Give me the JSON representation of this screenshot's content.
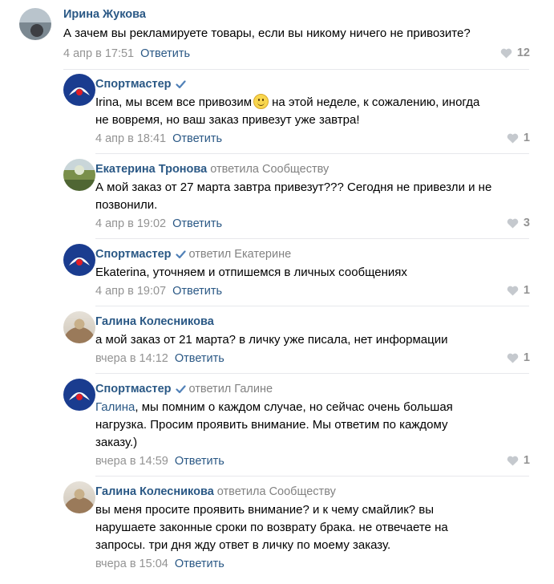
{
  "colors": {
    "link": "#2a5885",
    "muted": "#939393",
    "brand": "#1a3c8f",
    "separator": "#e7e8ec"
  },
  "reply_label": "Ответить",
  "comments": [
    {
      "author": "Ирина Жукова",
      "avatar_icon": "user-photo-icon",
      "verified": false,
      "reply_to": "",
      "lines": [
        "А зачем вы рекламируете товары, если вы никому ничего не привозите?"
      ],
      "time": "4 апр в 17:51",
      "likes": "12"
    },
    {
      "author": "Спортмастер",
      "avatar_icon": "brand-logo-icon",
      "verified": true,
      "reply_to": "",
      "line1_before": "Irina, мы всем все привозим",
      "line1_after": "на этой неделе, к сожалению, иногда",
      "line2": "не вовремя, но ваш заказ привезут уже завтра!",
      "time": "4 апр в 18:41",
      "likes": "1"
    },
    {
      "author": "Екатерина Тронова",
      "avatar_icon": "landscape-photo-icon",
      "verified": false,
      "reply_to": "ответила Сообществу",
      "lines": [
        "А мой заказ от 27 марта завтра привезут??? Сегодня не привезли и не",
        "позвонили."
      ],
      "time": "4 апр в 19:02",
      "likes": "3"
    },
    {
      "author": "Спортмастер",
      "avatar_icon": "brand-logo-icon",
      "verified": true,
      "reply_to": "ответил Екатерине",
      "lines": [
        "Ekaterina, уточняем и отпишемся в личных сообщениях"
      ],
      "time": "4 апр в 19:07",
      "likes": "1"
    },
    {
      "author": "Галина Колесникова",
      "avatar_icon": "user-photo-icon",
      "verified": false,
      "reply_to": "",
      "lines": [
        "а мой заказ от 21 марта? в личку уже писала, нет информации"
      ],
      "time": "вчера в 14:12",
      "likes": "1"
    },
    {
      "author": "Спортмастер",
      "avatar_icon": "brand-logo-icon",
      "verified": true,
      "reply_to": "ответил Галине",
      "mention": "Галина",
      "line1_rest": ", мы помним о каждом случае, но сейчас очень большая",
      "lines": [
        "нагрузка. Просим проявить внимание. Мы ответим по каждому",
        "заказу.)"
      ],
      "time": "вчера в 14:59",
      "likes": "1"
    },
    {
      "author": "Галина Колесникова",
      "avatar_icon": "user-photo-icon",
      "verified": false,
      "reply_to": "ответила Сообществу",
      "lines": [
        "вы меня просите проявить внимание? и к чему смайлик? вы",
        "нарушаете законные сроки по возврату брака. не отвечаете на",
        "запросы. три дня жду ответ в личку по моему заказу."
      ],
      "time": "вчера в 15:04",
      "likes": ""
    }
  ]
}
